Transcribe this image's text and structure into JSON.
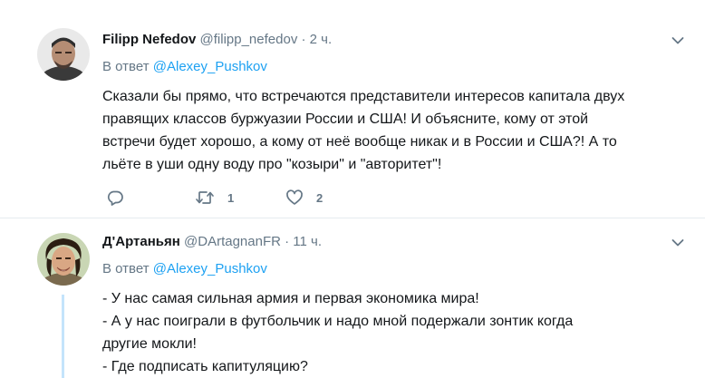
{
  "tweets": [
    {
      "display_name": "Filipp Nefedov",
      "handle": "@filipp_nefedov",
      "separator": "·",
      "time": "2 ч.",
      "reply_prefix": "В ответ",
      "reply_mention": "@Alexey_Pushkov",
      "text_lines": [
        "Сказали бы прямо, что встречаются представители интересов капитала двух",
        "правящих классов буржуазии России и США! И объясните, кому от этой",
        "встречи будет хорошо, а кому от неё вообще никак и в России и США?! А то",
        "льёте в уши одну воду про \"козыри\" и \"авторитет\"!"
      ],
      "retweet_count": "1",
      "like_count": "2"
    },
    {
      "display_name": "Д'Артаньян",
      "handle": "@DArtagnanFR",
      "separator": "·",
      "time": "11 ч.",
      "reply_prefix": "В ответ",
      "reply_mention": "@Alexey_Pushkov",
      "text_lines": [
        "- У нас самая сильная армия и первая экономика мира!",
        "- А у нас поиграли в футбольчик и надо мной подержали зонтик когда",
        "другие мокли!",
        "- Где подписать капитуляцию?"
      ]
    }
  ],
  "icons": {
    "more": "chevron-down-icon",
    "reply": "reply-icon",
    "retweet": "retweet-icon",
    "like": "heart-icon"
  },
  "colors": {
    "text": "#14171a",
    "secondary": "#657786",
    "link": "#1da1f2",
    "divider": "#e6ecf0",
    "thread_line": "#c4e4fb"
  }
}
